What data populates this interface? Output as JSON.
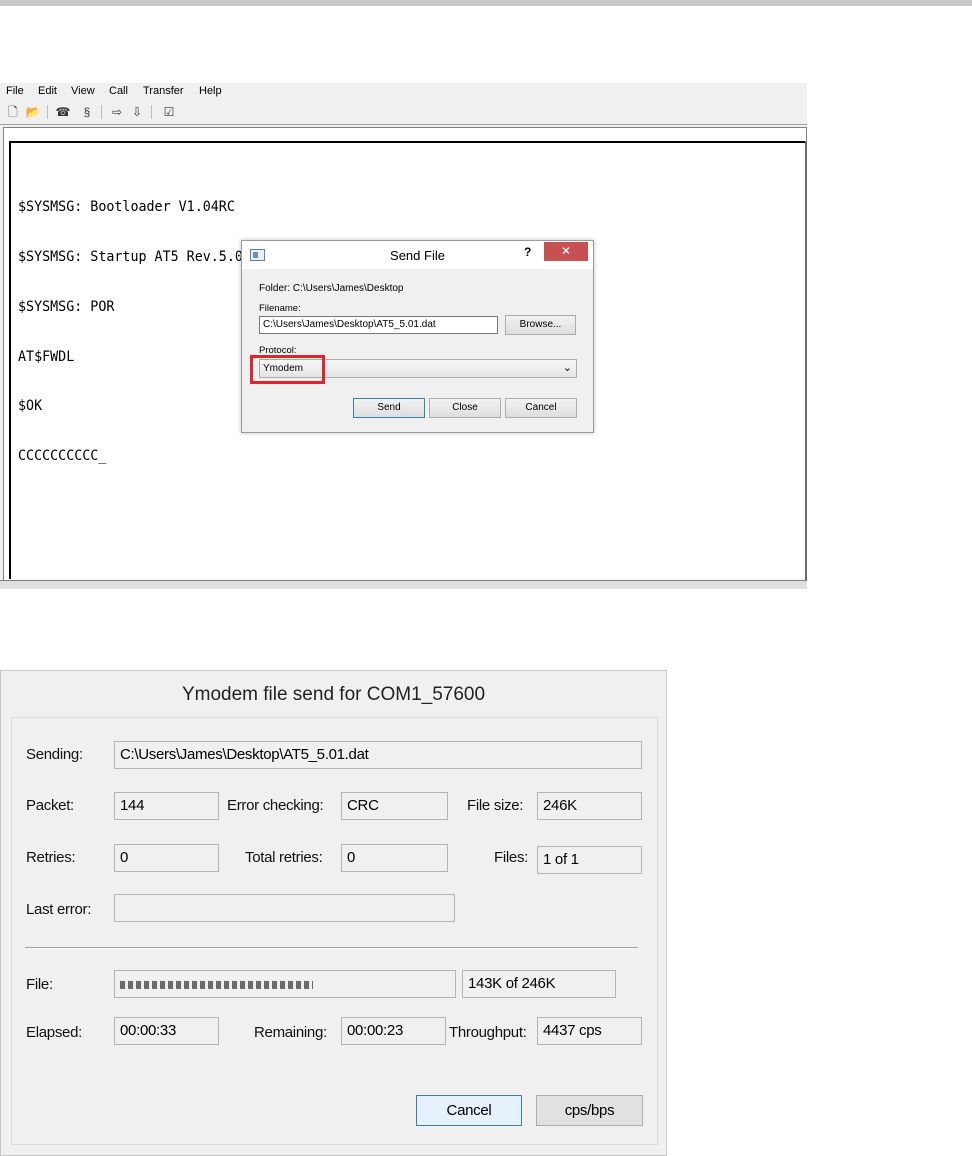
{
  "terminal_window": {
    "menu": [
      "File",
      "Edit",
      "View",
      "Call",
      "Transfer",
      "Help"
    ],
    "toolbar_icons": [
      "new-icon",
      "open-icon",
      "disconnect-icon",
      "call-icon",
      "send-icon",
      "receive-icon",
      "properties-icon"
    ],
    "lines": [
      "$SYSMSG: Bootloader V1.04RC",
      "$SYSMSG: Startup AT5 Rev.5.00",
      "$SYSMSG: POR",
      "AT$FWDL",
      "$OK",
      "CCCCCCCCCC_"
    ]
  },
  "send_file_dialog": {
    "title": "Send File",
    "help": "?",
    "close": "✕",
    "folder_label": "Folder: C:\\Users\\James\\Desktop",
    "filename_label": "Filename:",
    "filename_value": "C:\\Users\\James\\Desktop\\AT5_5.01.dat",
    "browse_label": "Browse...",
    "protocol_label": "Protocol:",
    "protocol_value": "Ymodem",
    "send_label": "Send",
    "close_label": "Close",
    "cancel_label": "Cancel",
    "highlight_color": "#e3242b"
  },
  "ymodem_dialog": {
    "title": "Ymodem file send for COM1_57600",
    "sending_label": "Sending:",
    "sending_value": "C:\\Users\\James\\Desktop\\AT5_5.01.dat",
    "packet_label": "Packet:",
    "packet_value": "144",
    "error_checking_label": "Error checking:",
    "error_checking_value": "CRC",
    "file_size_label": "File size:",
    "file_size_value": "246K",
    "retries_label": "Retries:",
    "retries_value": "0",
    "total_retries_label": "Total retries:",
    "total_retries_value": "0",
    "files_label": "Files:",
    "files_value": "1 of 1",
    "last_error_label": "Last error:",
    "last_error_value": "",
    "file_label": "File:",
    "file_progress_fraction": 0.58,
    "file_progress_text": "143K of 246K",
    "elapsed_label": "Elapsed:",
    "elapsed_value": "00:00:33",
    "remaining_label": "Remaining:",
    "remaining_value": "00:00:23",
    "throughput_label": "Throughput:",
    "throughput_value": "4437 cps",
    "cancel_label": "Cancel",
    "cps_bps_label": "cps/bps"
  }
}
